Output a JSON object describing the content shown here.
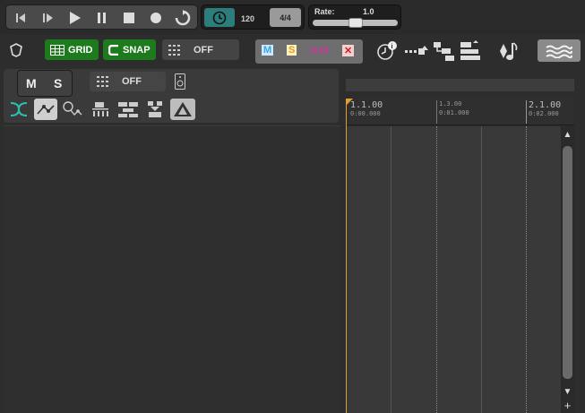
{
  "transport": {
    "buttons": [
      "skip-back",
      "skip-forward",
      "play",
      "pause",
      "stop",
      "record",
      "loop"
    ]
  },
  "tempo": {
    "bpm": "120",
    "meter": "4/4"
  },
  "rate": {
    "label": "Rate:",
    "value": "1.0",
    "level": 0.5
  },
  "toolbar": {
    "grid_label": "GRID",
    "snap_label": "SNAP",
    "off_label": "OFF",
    "m_label": "M",
    "s_label": "S",
    "mult_label": "mult",
    "x_label": "✕"
  },
  "track_panel": {
    "mute_label": "M",
    "solo_label": "S",
    "off_label": "OFF"
  },
  "ruler": {
    "marks": [
      {
        "bar": "1.1.00",
        "time": "0:00.000"
      },
      {
        "bar": "1.3.00",
        "time": "0:01.000"
      },
      {
        "bar": "2.1.00",
        "time": "0:02.000"
      }
    ]
  },
  "colors": {
    "accent_green": "#1d7a1d",
    "teal": "#2e7d7d",
    "playhead": "#e0a030"
  }
}
